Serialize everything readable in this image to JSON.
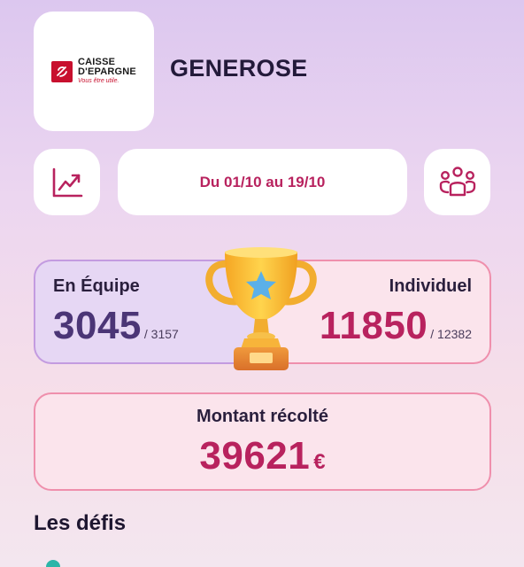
{
  "header": {
    "logo": {
      "brand_line1": "CAISSE",
      "brand_line2": "D'EPARGNE",
      "tagline": "Vous être utile."
    },
    "title": "GENEROSE"
  },
  "toolbar": {
    "date_range": "Du 01/10 au 19/10",
    "stats_icon": "trending-up-icon",
    "team_icon": "users-group-icon"
  },
  "stats": {
    "team": {
      "label": "En Équipe",
      "value": "3045",
      "total": "/ 3157"
    },
    "individual": {
      "label": "Individuel",
      "value": "11850",
      "total": "/ 12382"
    }
  },
  "amount": {
    "label": "Montant récolté",
    "value": "39621",
    "currency": "€"
  },
  "challenges": {
    "title": "Les défis"
  },
  "colors": {
    "accent": "#b8225e",
    "team": "#4b3576",
    "brand_red": "#c8102e"
  }
}
